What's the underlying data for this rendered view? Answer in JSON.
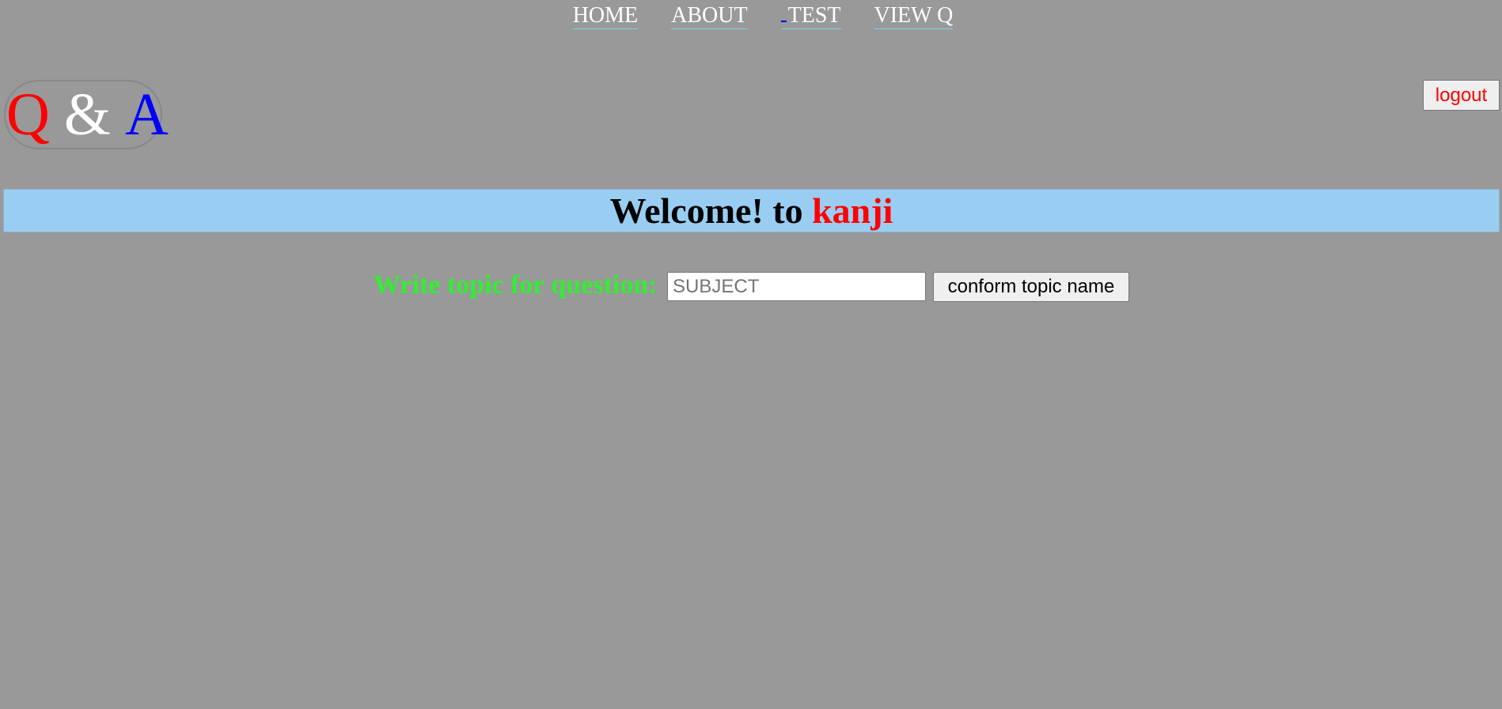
{
  "nav": {
    "items": [
      {
        "label": "HOME"
      },
      {
        "label": "ABOUT"
      },
      {
        "label": "TEST"
      },
      {
        "label": "VIEW Q"
      }
    ]
  },
  "logo": {
    "q": "Q",
    "amp": "&",
    "a": "A"
  },
  "header": {
    "logout_label": "logout"
  },
  "welcome": {
    "prefix": "Welcome! to ",
    "username": "kanji"
  },
  "topic_form": {
    "label": "Write topic for question:",
    "input_value": "",
    "input_placeholder": "SUBJECT",
    "confirm_label": "conform topic name"
  },
  "colors": {
    "background": "#999999",
    "banner": "#99cef2",
    "accent_red": "#ff0000",
    "accent_blue": "#0000ff",
    "label_green": "#33ee33"
  }
}
